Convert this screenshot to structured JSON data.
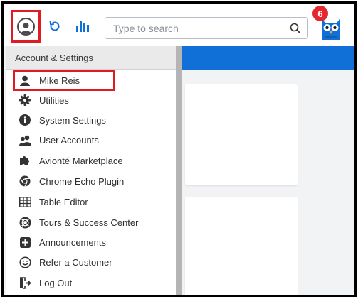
{
  "toolbar": {
    "search_placeholder": "Type to search",
    "notification_count": "6"
  },
  "dropdown": {
    "header": "Account & Settings",
    "items": [
      {
        "label": "Mike Reis",
        "icon": "user-icon"
      },
      {
        "label": "Utilities",
        "icon": "gear-icon"
      },
      {
        "label": "System Settings",
        "icon": "info-icon"
      },
      {
        "label": "User Accounts",
        "icon": "users-icon"
      },
      {
        "label": "Avionté Marketplace",
        "icon": "puzzle-icon"
      },
      {
        "label": "Chrome Echo Plugin",
        "icon": "chrome-icon"
      },
      {
        "label": "Table Editor",
        "icon": "table-icon"
      },
      {
        "label": "Tours & Success Center",
        "icon": "lifebuoy-icon"
      },
      {
        "label": "Announcements",
        "icon": "plus-square-icon"
      },
      {
        "label": "Refer a Customer",
        "icon": "smile-icon"
      },
      {
        "label": "Log Out",
        "icon": "logout-icon"
      }
    ]
  },
  "colors": {
    "accent_blue": "#1170d8",
    "highlight_red": "#e01b24",
    "badge_red": "#e5282e"
  }
}
